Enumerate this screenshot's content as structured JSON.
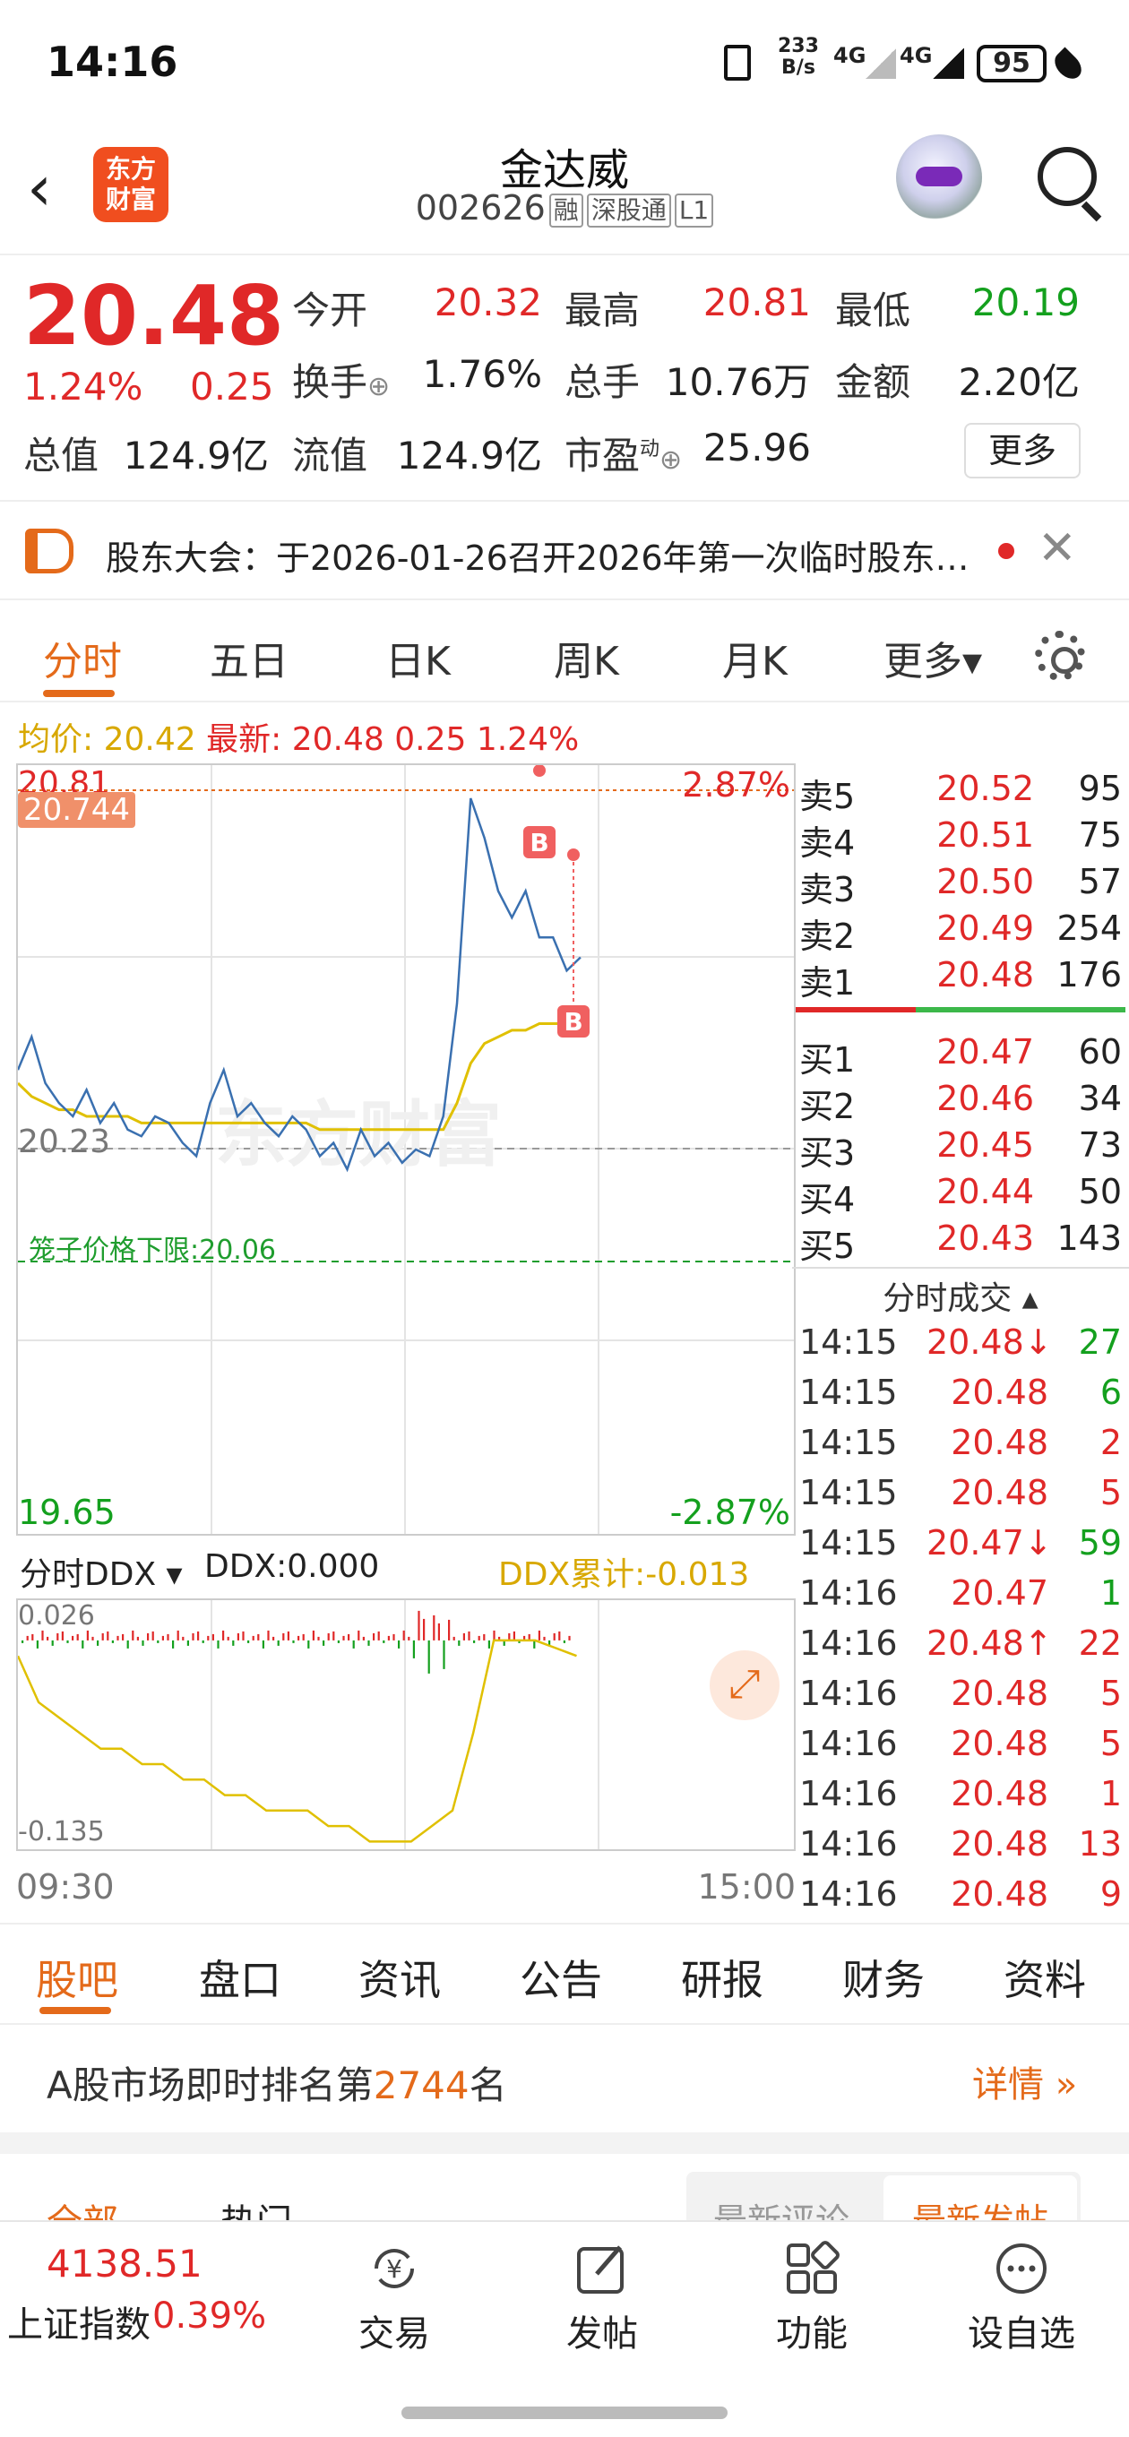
{
  "status_bar": {
    "time": "14:16",
    "net_speed_value": "233",
    "net_speed_unit": "B/s",
    "network_1": "4G",
    "network_2": "4G",
    "battery": "95"
  },
  "header": {
    "logo_text_1": "东方",
    "logo_text_2": "财富",
    "stock_name": "金达威",
    "stock_code": "002626",
    "tags": [
      "融",
      "深股通",
      "L1"
    ]
  },
  "quote": {
    "price": "20.48",
    "change_pct": "1.24%",
    "change": "0.25",
    "open_label": "今开",
    "open": "20.32",
    "high_label": "最高",
    "high": "20.81",
    "low_label": "最低",
    "low": "20.19",
    "turnover_label": "换手",
    "turnover": "1.76%",
    "volume_label": "总手",
    "volume": "10.76万",
    "amount_label": "金额",
    "amount": "2.20亿",
    "market_cap_label": "总值",
    "market_cap": "124.9亿",
    "float_cap_label": "流值",
    "float_cap": "124.9亿",
    "pe_label": "市盈",
    "pe_sup": "动",
    "pe": "25.96",
    "more_label": "更多"
  },
  "notice": {
    "text": "股东大会：于2026-01-26召开2026年第一次临时股东…"
  },
  "chart_tabs": [
    "分时",
    "五日",
    "日K",
    "周K",
    "月K",
    "更多▾"
  ],
  "avg_line": {
    "avg_label": "均价:",
    "avg": "20.42",
    "latest_label": "最新:",
    "latest": "20.48",
    "change": "0.25",
    "pct": "1.24%"
  },
  "chart_labels": {
    "top_price": "20.81",
    "cursor_price": "20.744",
    "top_pct": "2.87%",
    "mid_price": "20.23",
    "bottom_price": "19.65",
    "bottom_pct": "-2.87%",
    "cage_label": "笼子价格下限:20.06",
    "buy_marker": "B",
    "watermark": "东方财富",
    "time_start": "09:30",
    "time_end": "15:00"
  },
  "chart_data": {
    "type": "line",
    "ylim": [
      19.65,
      20.81
    ],
    "pct_range": [
      "-2.87%",
      "2.87%"
    ],
    "prev_close": 20.23,
    "cage_lower_limit": 20.06,
    "x_range": [
      "09:30",
      "15:00"
    ],
    "series": [
      {
        "values": [
          20.35,
          20.4,
          20.33,
          20.3,
          20.28,
          20.32,
          20.27,
          20.3,
          20.26,
          20.25,
          20.28,
          20.27,
          20.24,
          20.22,
          20.3,
          20.35,
          20.28,
          20.3,
          20.27,
          20.25,
          20.28,
          20.26,
          20.22,
          20.24,
          20.2,
          20.26,
          20.22,
          20.24,
          20.21,
          20.23,
          20.22,
          20.28,
          20.45,
          20.76,
          20.7,
          20.62,
          20.58,
          20.62,
          20.55,
          20.55,
          20.5,
          20.52
        ]
      },
      {
        "name": "均价",
        "values": [
          20.33,
          20.31,
          20.3,
          20.29,
          20.29,
          20.28,
          20.28,
          20.28,
          20.28,
          20.27,
          20.27,
          20.27,
          20.27,
          20.27,
          20.27,
          20.27,
          20.27,
          20.27,
          20.27,
          20.27,
          20.27,
          20.27,
          20.26,
          20.26,
          20.26,
          20.26,
          20.26,
          20.26,
          20.26,
          20.26,
          20.26,
          20.26,
          20.3,
          20.36,
          20.39,
          20.4,
          20.41,
          20.41,
          20.42,
          20.42,
          20.42,
          20.42
        ]
      }
    ]
  },
  "ddx": {
    "selector": "分时DDX ▾",
    "value_label": "DDX:",
    "value": "0.000",
    "cum_label": "DDX累计:",
    "cum": "-0.013",
    "ymax_label": "0.026",
    "ymin_label": "-0.135",
    "chart_data": {
      "type": "line",
      "ylim": [
        -0.135,
        0.026
      ],
      "values": [
        -0.01,
        -0.04,
        -0.05,
        -0.06,
        -0.07,
        -0.07,
        -0.08,
        -0.08,
        -0.09,
        -0.09,
        -0.1,
        -0.1,
        -0.11,
        -0.11,
        -0.11,
        -0.12,
        -0.12,
        -0.13,
        -0.13,
        -0.13,
        -0.12,
        -0.11,
        -0.06,
        0.0,
        0.0,
        0.0,
        -0.005,
        -0.01
      ]
    }
  },
  "order_book": {
    "asks": [
      {
        "label": "卖5",
        "price": "20.52",
        "vol": "95"
      },
      {
        "label": "卖4",
        "price": "20.51",
        "vol": "75"
      },
      {
        "label": "卖3",
        "price": "20.50",
        "vol": "57"
      },
      {
        "label": "卖2",
        "price": "20.49",
        "vol": "254"
      },
      {
        "label": "卖1",
        "price": "20.48",
        "vol": "176"
      }
    ],
    "bids": [
      {
        "label": "买1",
        "price": "20.47",
        "vol": "60"
      },
      {
        "label": "买2",
        "price": "20.46",
        "vol": "34"
      },
      {
        "label": "买3",
        "price": "20.45",
        "vol": "73"
      },
      {
        "label": "买4",
        "price": "20.44",
        "vol": "50"
      },
      {
        "label": "买5",
        "price": "20.43",
        "vol": "143"
      }
    ],
    "ticks_title": "分时成交 ▴",
    "ticks": [
      {
        "time": "14:15",
        "price": "20.48↓",
        "vol": "27",
        "dir": "down"
      },
      {
        "time": "14:15",
        "price": "20.48",
        "vol": "6",
        "dir": "down"
      },
      {
        "time": "14:15",
        "price": "20.48",
        "vol": "2",
        "dir": "up"
      },
      {
        "time": "14:15",
        "price": "20.48",
        "vol": "5",
        "dir": "up"
      },
      {
        "time": "14:15",
        "price": "20.47↓",
        "vol": "59",
        "dir": "down"
      },
      {
        "time": "14:16",
        "price": "20.47",
        "vol": "1",
        "dir": "down"
      },
      {
        "time": "14:16",
        "price": "20.48↑",
        "vol": "22",
        "dir": "up"
      },
      {
        "time": "14:16",
        "price": "20.48",
        "vol": "5",
        "dir": "up"
      },
      {
        "time": "14:16",
        "price": "20.48",
        "vol": "5",
        "dir": "up"
      },
      {
        "time": "14:16",
        "price": "20.48",
        "vol": "1",
        "dir": "up"
      },
      {
        "time": "14:16",
        "price": "20.48",
        "vol": "13",
        "dir": "up"
      },
      {
        "time": "14:16",
        "price": "20.48",
        "vol": "9",
        "dir": "up"
      }
    ]
  },
  "bottom_tabs": [
    "股吧",
    "盘口",
    "资讯",
    "公告",
    "研报",
    "财务",
    "资料"
  ],
  "rank": {
    "prefix": "A股市场即时排名第",
    "number": "2744",
    "suffix": "名",
    "link": "详情 »"
  },
  "post_tabs": {
    "all": "全部",
    "hot": "热门",
    "latest_comment": "最新评论",
    "latest_post": "最新发帖"
  },
  "bottom_bar": {
    "index_value": "4138.51",
    "index_name": "上证指数",
    "index_pct": "0.39%",
    "buttons": [
      "交易",
      "发帖",
      "功能",
      "设自选"
    ]
  },
  "colors": {
    "up": "#e02828",
    "down": "#14a01e",
    "accent": "#e46a1a",
    "price_line": "#3a70b0",
    "avg_line": "#e0c000"
  }
}
